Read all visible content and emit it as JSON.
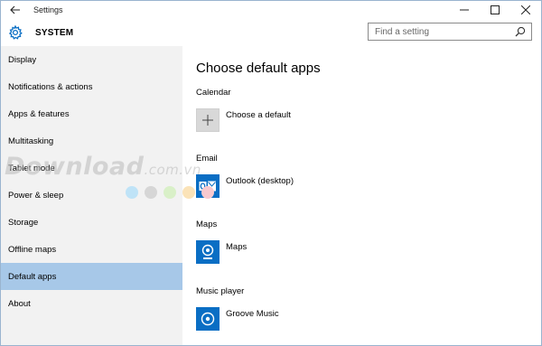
{
  "titlebar": {
    "title": "Settings"
  },
  "header": {
    "section": "SYSTEM",
    "search_placeholder": "Find a setting"
  },
  "sidebar": {
    "items": [
      {
        "label": "Display"
      },
      {
        "label": "Notifications & actions"
      },
      {
        "label": "Apps & features"
      },
      {
        "label": "Multitasking"
      },
      {
        "label": "Tablet mode"
      },
      {
        "label": "Power & sleep"
      },
      {
        "label": "Storage"
      },
      {
        "label": "Offline maps"
      },
      {
        "label": "Default apps"
      },
      {
        "label": "About"
      }
    ],
    "active_index": 8
  },
  "main": {
    "title": "Choose default apps",
    "sections": [
      {
        "label": "Calendar",
        "app": "Choose a default",
        "icon": "plus-icon"
      },
      {
        "label": "Email",
        "app": "Outlook (desktop)",
        "icon": "outlook-icon"
      },
      {
        "label": "Maps",
        "app": "Maps",
        "icon": "maps-icon"
      },
      {
        "label": "Music player",
        "app": "Groove Music",
        "icon": "groove-music-icon"
      }
    ]
  },
  "watermark": {
    "text": "Download",
    "domain": ".com.vn"
  },
  "colors": {
    "accent": "#0a6ec4",
    "selected": "#a7c8e8",
    "sidebar_bg": "#f2f2f2",
    "watermark_dots": [
      "#bfe3f7",
      "#d6d6d6",
      "#d9f0c8",
      "#fbe3b8",
      "#f8c9cf"
    ]
  }
}
